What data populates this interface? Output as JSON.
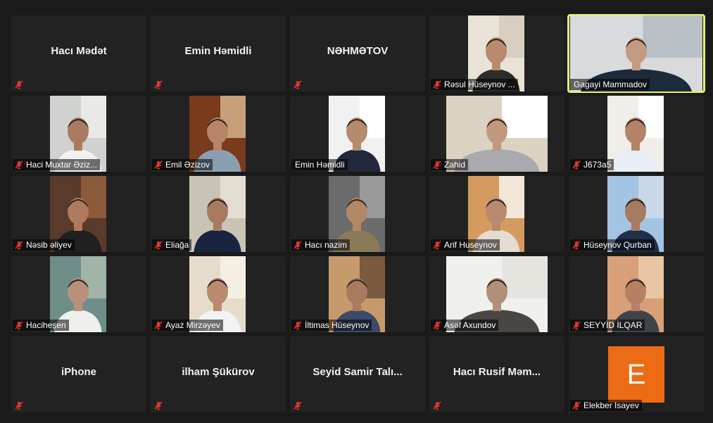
{
  "meeting": {
    "active_speaker_color": "#e7f26a",
    "muted_icon_color": "#e8352e",
    "participants": [
      {
        "name": "Hacı Mədət",
        "video": false
      },
      {
        "name": "Emin Həmidli",
        "video": false
      },
      {
        "name": "NƏHMƏTOV",
        "video": false
      },
      {
        "name": "Rəsul Hüseynov ...",
        "video": true,
        "muted": true
      },
      {
        "name": "Gagayi Mammadov",
        "video": true,
        "muted": false,
        "active": true
      },
      {
        "name": "Haci Muxtar Əziz...",
        "video": true,
        "muted": true
      },
      {
        "name": "Emil Əzizov",
        "video": true,
        "muted": true
      },
      {
        "name": "Emin Həmidli",
        "video": true,
        "muted": false
      },
      {
        "name": "Zahid",
        "video": true,
        "muted": true
      },
      {
        "name": "J673a5",
        "video": true,
        "muted": true
      },
      {
        "name": "Nəsib əliyev",
        "video": true,
        "muted": true
      },
      {
        "name": "Eliağa",
        "video": true,
        "muted": true
      },
      {
        "name": "Hacı nazim",
        "video": true,
        "muted": true
      },
      {
        "name": "Arif Huseynov",
        "video": true,
        "muted": true
      },
      {
        "name": "Hüseynov Qurban",
        "video": true,
        "muted": true
      },
      {
        "name": "Haciheşen",
        "video": true,
        "muted": true
      },
      {
        "name": "Ayaz Mirzəyev",
        "video": true,
        "muted": true
      },
      {
        "name": "İltimas Hüseynov",
        "video": true,
        "muted": true
      },
      {
        "name": "Asəf Axundov",
        "video": true,
        "muted": true
      },
      {
        "name": "SEYYİD  İLQAR",
        "video": true,
        "muted": true
      },
      {
        "name": "iPhone",
        "video": false
      },
      {
        "name": "ilham Şükürov",
        "video": false
      },
      {
        "name": "Seyid  Samir Talı...",
        "video": false
      },
      {
        "name": "Hacı Rusif Məm...",
        "video": false
      },
      {
        "name": "Elekber Isayev",
        "video": false,
        "avatar_letter": "E",
        "avatar_color": "#ec6c16"
      }
    ]
  }
}
